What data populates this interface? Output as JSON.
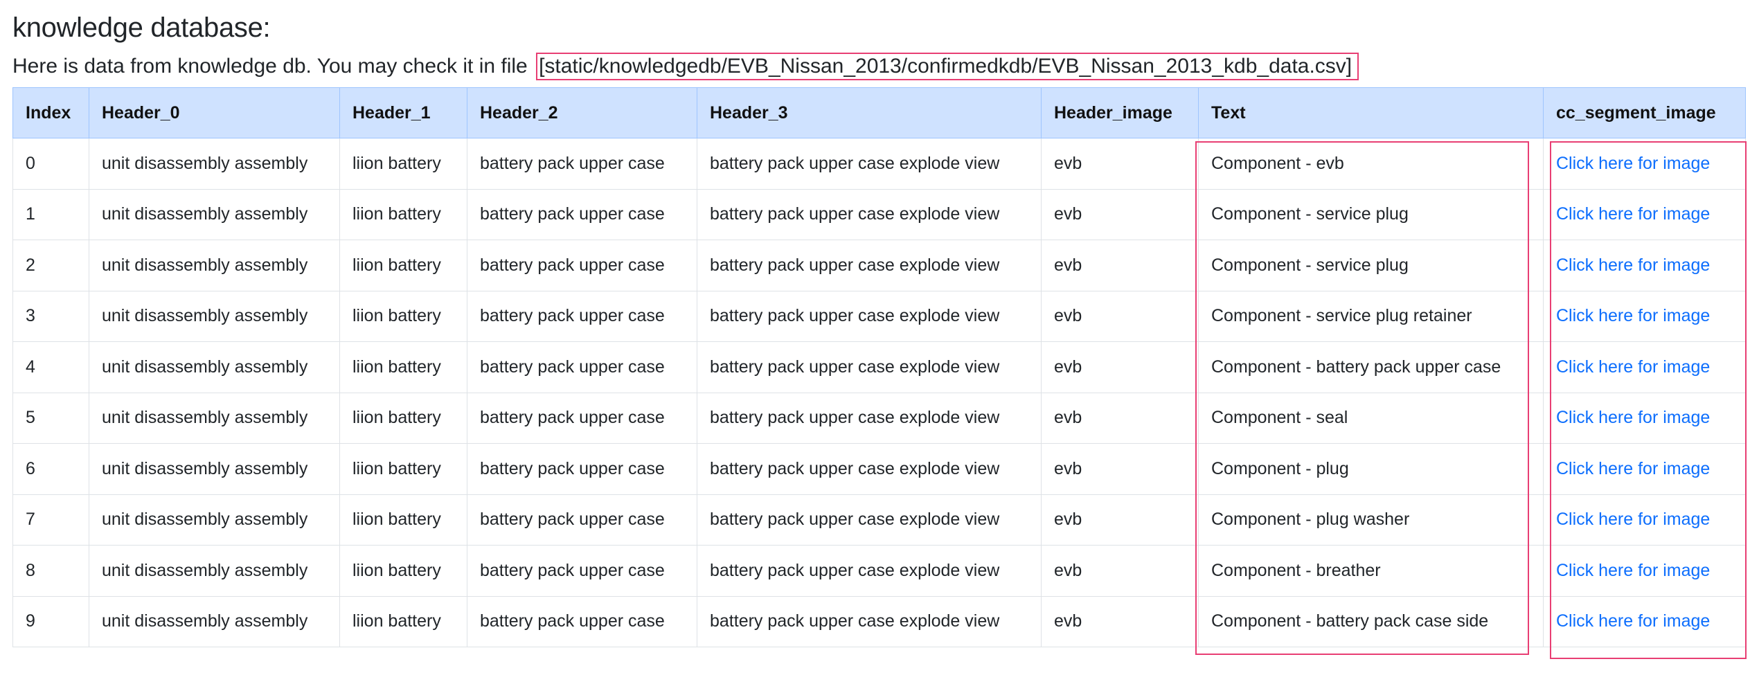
{
  "page": {
    "title": "knowledge database:",
    "intro_text": "Here is data from knowledge db. You may check it in file",
    "file_path": "[static/knowledgedb/EVB_Nissan_2013/confirmedkdb/EVB_Nissan_2013_kdb_data.csv]"
  },
  "table": {
    "headers": [
      "Index",
      "Header_0",
      "Header_1",
      "Header_2",
      "Header_3",
      "Header_image",
      "Text",
      "cc_segment_image"
    ],
    "rows": [
      [
        "0",
        "unit disassembly assembly",
        "liion battery",
        "battery pack upper case",
        "battery pack upper case explode view",
        "evb",
        "Component - evb",
        "Click here for image"
      ],
      [
        "1",
        "unit disassembly assembly",
        "liion battery",
        "battery pack upper case",
        "battery pack upper case explode view",
        "evb",
        "Component - service plug",
        "Click here for image"
      ],
      [
        "2",
        "unit disassembly assembly",
        "liion battery",
        "battery pack upper case",
        "battery pack upper case explode view",
        "evb",
        "Component - service plug",
        "Click here for image"
      ],
      [
        "3",
        "unit disassembly assembly",
        "liion battery",
        "battery pack upper case",
        "battery pack upper case explode view",
        "evb",
        "Component - service plug retainer",
        "Click here for image"
      ],
      [
        "4",
        "unit disassembly assembly",
        "liion battery",
        "battery pack upper case",
        "battery pack upper case explode view",
        "evb",
        "Component - battery pack upper case",
        "Click here for image"
      ],
      [
        "5",
        "unit disassembly assembly",
        "liion battery",
        "battery pack upper case",
        "battery pack upper case explode view",
        "evb",
        "Component - seal",
        "Click here for image"
      ],
      [
        "6",
        "unit disassembly assembly",
        "liion battery",
        "battery pack upper case",
        "battery pack upper case explode view",
        "evb",
        "Component - plug",
        "Click here for image"
      ],
      [
        "7",
        "unit disassembly assembly",
        "liion battery",
        "battery pack upper case",
        "battery pack upper case explode view",
        "evb",
        "Component - plug washer",
        "Click here for image"
      ],
      [
        "8",
        "unit disassembly assembly",
        "liion battery",
        "battery pack upper case",
        "battery pack upper case explode view",
        "evb",
        "Component - breather",
        "Click here for image"
      ],
      [
        "9",
        "unit disassembly assembly",
        "liion battery",
        "battery pack upper case",
        "battery pack upper case explode view",
        "evb",
        "Component - battery pack case side",
        "Click here for image"
      ]
    ]
  },
  "colors": {
    "header_bg": "#cfe2ff",
    "link": "#0d6efd",
    "highlight": "#e83e73"
  }
}
